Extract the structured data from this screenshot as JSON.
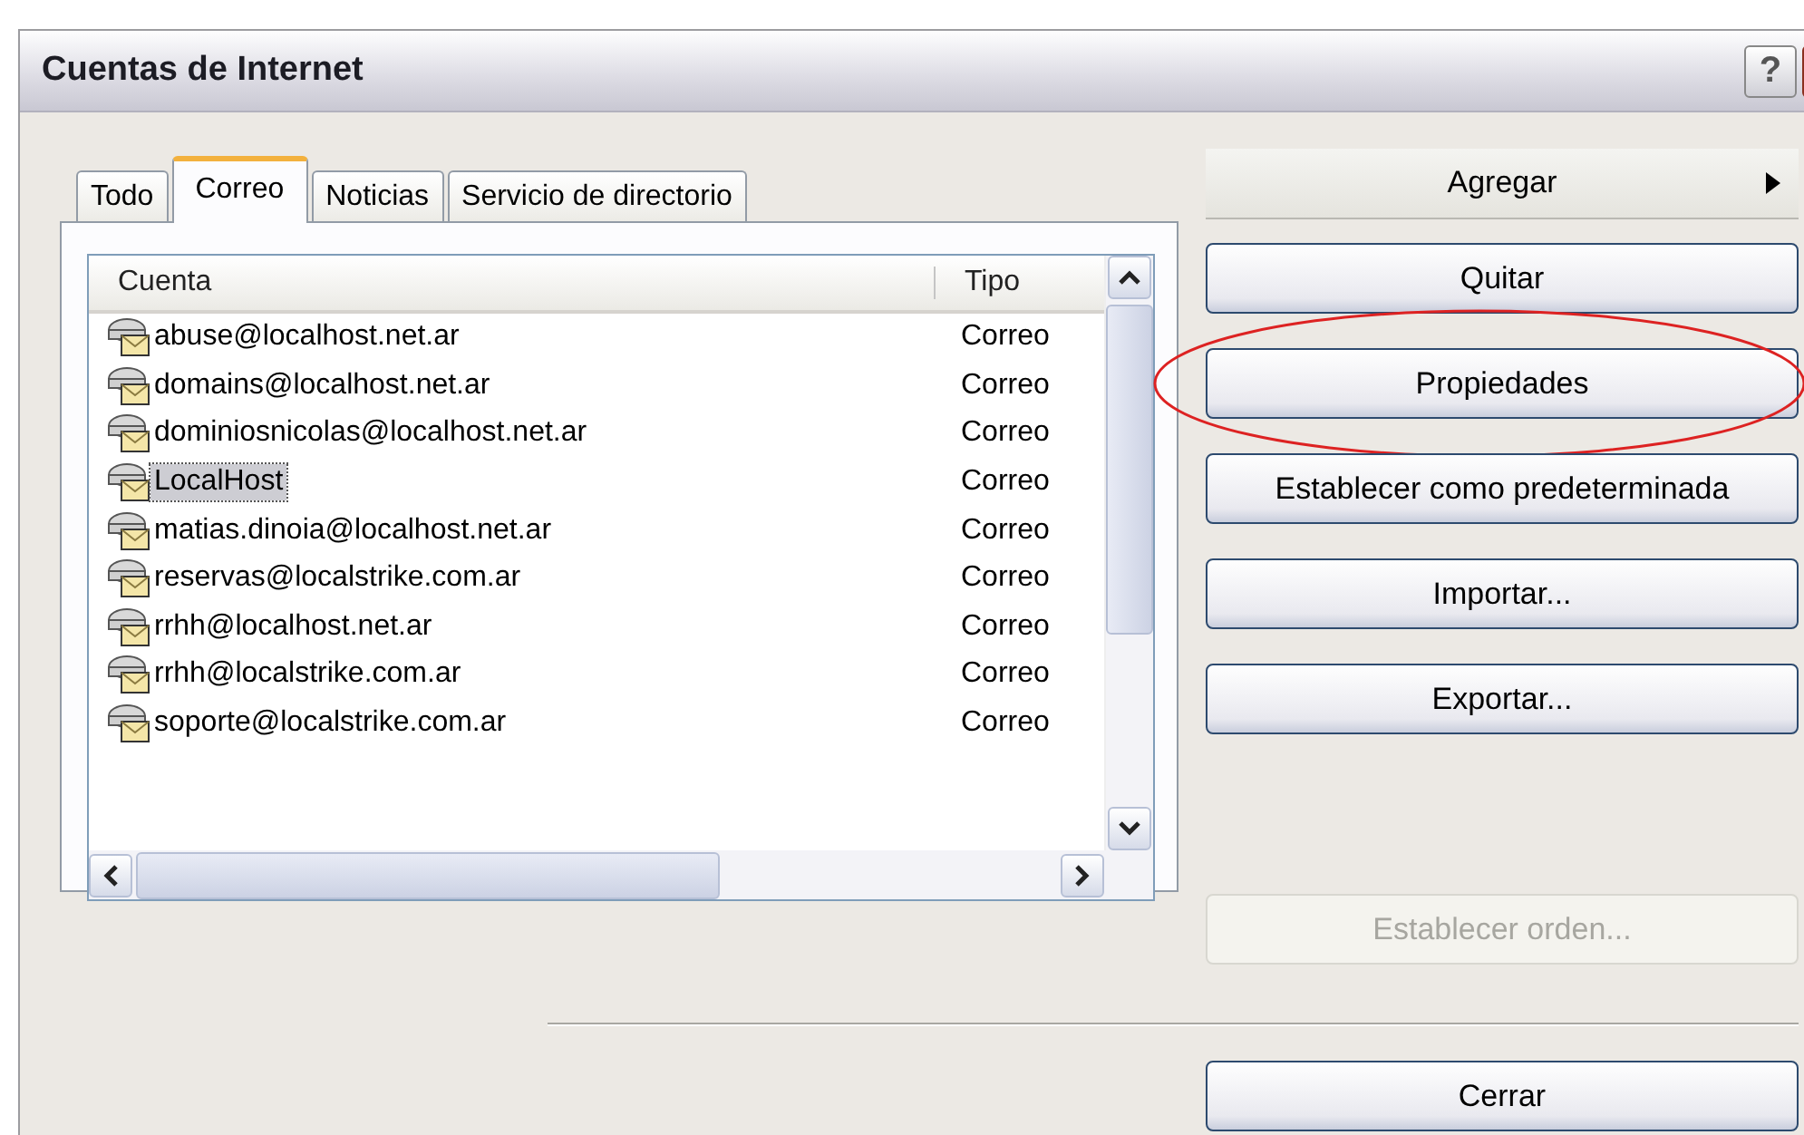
{
  "window": {
    "title": "Cuentas de Internet",
    "buttons": [
      "?"
    ]
  },
  "tabs": [
    {
      "label": "Todo",
      "selected": false
    },
    {
      "label": "Correo",
      "selected": true
    },
    {
      "label": "Noticias",
      "selected": false
    },
    {
      "label": "Servicio de directorio",
      "selected": false
    }
  ],
  "table": {
    "columns": [
      "Cuenta",
      "Tipo"
    ],
    "rows": [
      {
        "cells": [
          "abuse@localhost.net.ar",
          "Correo"
        ],
        "selected": false
      },
      {
        "cells": [
          "domains@localhost.net.ar",
          "Correo"
        ],
        "selected": false
      },
      {
        "cells": [
          "dominiosnicolas@localhost.net.ar",
          "Correo"
        ],
        "selected": false
      },
      {
        "cells": [
          "LocalHost",
          "Correo"
        ],
        "selected": true
      },
      {
        "cells": [
          "matias.dinoia@localhost.net.ar",
          "Correo"
        ],
        "selected": false
      },
      {
        "cells": [
          "reservas@localstrike.com.ar",
          "Correo"
        ],
        "selected": false
      },
      {
        "cells": [
          "rrhh@localhost.net.ar",
          "Correo"
        ],
        "selected": false
      },
      {
        "cells": [
          "rrhh@localstrike.com.ar",
          "Correo"
        ],
        "selected": false
      },
      {
        "cells": [
          "soporte@localstrike.com.ar",
          "Correo"
        ],
        "selected": false
      }
    ]
  },
  "actions": [
    {
      "label": "Agregar",
      "kind": "menu",
      "disabled": false,
      "highlighted": false
    },
    {
      "label": "Quitar",
      "kind": "button",
      "disabled": false,
      "highlighted": false
    },
    {
      "label": "Propiedades",
      "kind": "button",
      "disabled": false,
      "highlighted": true
    },
    {
      "label": "Establecer como predeterminada",
      "kind": "button",
      "disabled": false,
      "highlighted": false
    },
    {
      "label": "Importar...",
      "kind": "button",
      "disabled": false,
      "highlighted": false
    },
    {
      "label": "Exportar...",
      "kind": "button",
      "disabled": false,
      "highlighted": false
    },
    {
      "label": "Establecer orden...",
      "kind": "button",
      "disabled": true,
      "highlighted": false
    }
  ],
  "footer_buttons": [
    "Cerrar"
  ]
}
